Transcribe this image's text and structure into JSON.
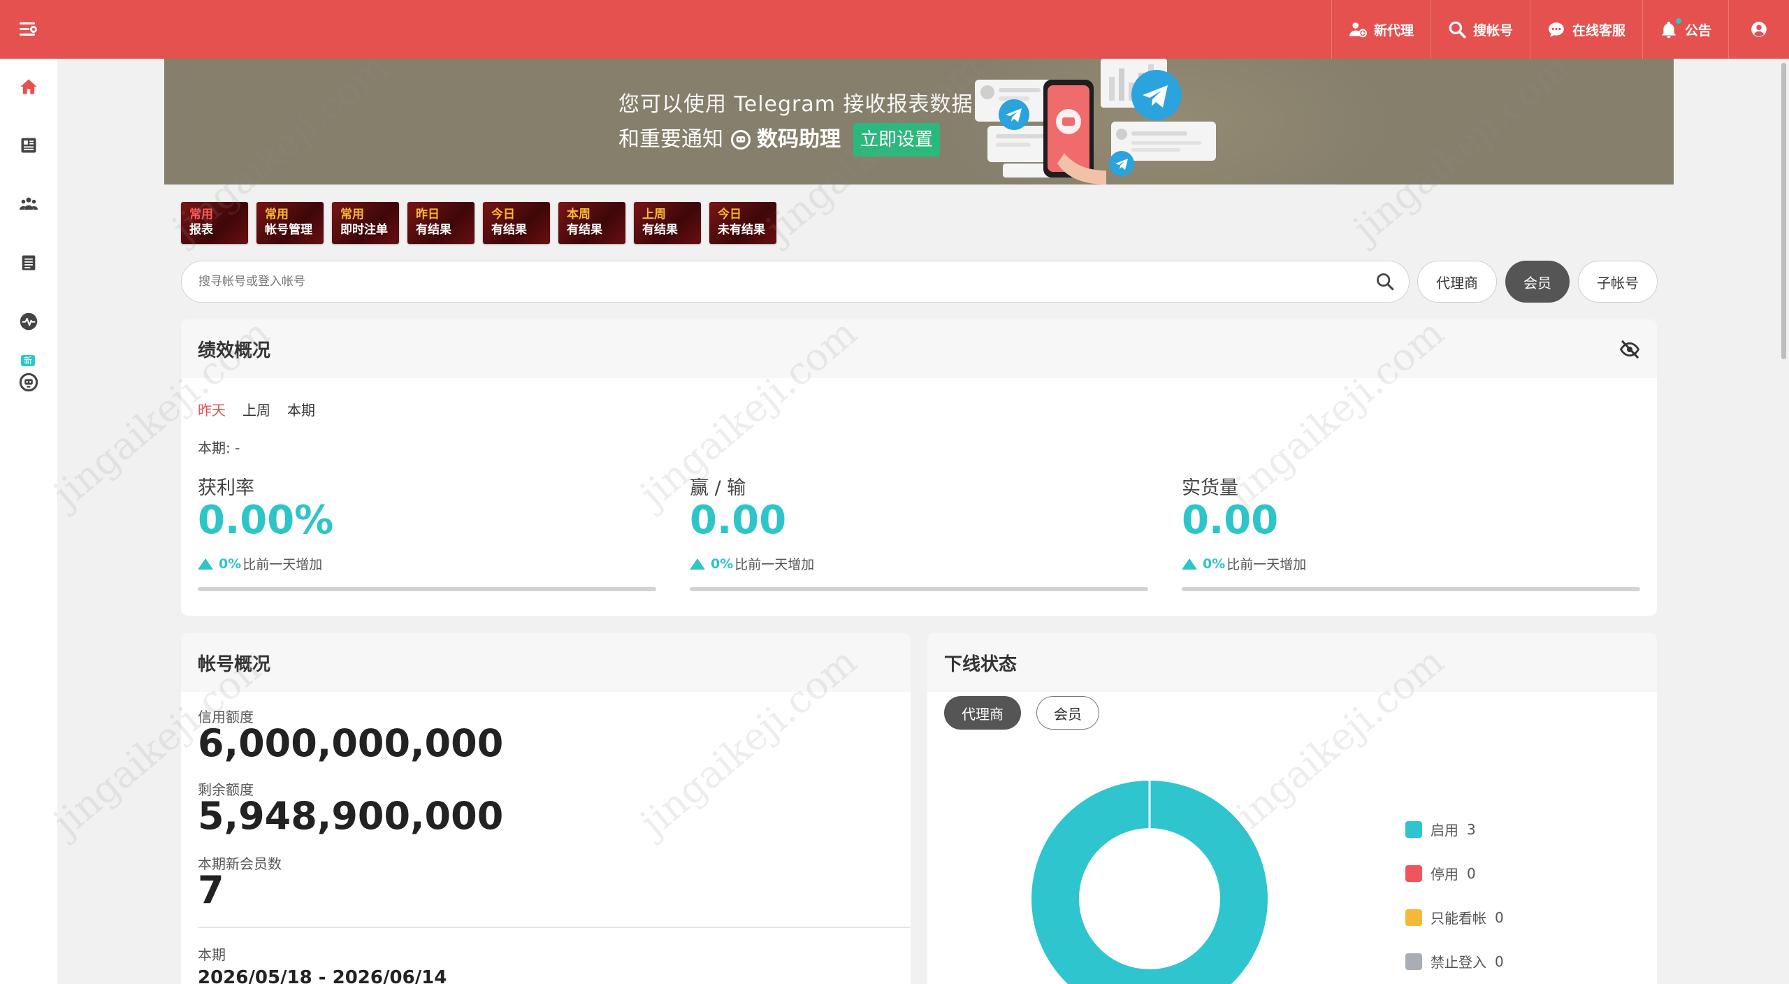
{
  "topbar": {
    "actions": [
      {
        "label": "新代理",
        "icon": "add-user-icon"
      },
      {
        "label": "搜帐号",
        "icon": "search-icon"
      },
      {
        "label": "在线客服",
        "icon": "chat-icon"
      },
      {
        "label": "公告",
        "icon": "bell-icon"
      }
    ],
    "user_icon": "user-circle-icon"
  },
  "sidebar": {
    "items": [
      {
        "icon": "home-icon",
        "active": true
      },
      {
        "icon": "report-icon"
      },
      {
        "icon": "team-icon"
      },
      {
        "icon": "list-icon"
      },
      {
        "icon": "pulse-icon"
      },
      {
        "icon": "bot-icon",
        "badge": "新"
      }
    ]
  },
  "banner": {
    "line1": "您可以使用 Telegram 接收报表数据",
    "line2_prefix": "和重要通知",
    "bot_name": "数码助理",
    "cta": "立即设置"
  },
  "shortcuts": [
    {
      "top": "常用",
      "bottom": "报表"
    },
    {
      "top": "常用",
      "bottom": "帐号管理"
    },
    {
      "top": "常用",
      "bottom": "即时注单"
    },
    {
      "top": "昨日",
      "bottom": "有结果"
    },
    {
      "top": "今日",
      "bottom": "有结果"
    },
    {
      "top": "本周",
      "bottom": "有结果"
    },
    {
      "top": "上周",
      "bottom": "有结果"
    },
    {
      "top": "今日",
      "bottom": "未有结果"
    }
  ],
  "search": {
    "placeholder": "搜寻帐号或登入帐号",
    "value": "",
    "types": [
      "代理商",
      "会员",
      "子帐号"
    ],
    "selected": "会员"
  },
  "performance": {
    "title": "绩效概况",
    "tabs": [
      "昨天",
      "上周",
      "本期"
    ],
    "active_tab": "昨天",
    "period_label": "本期: -",
    "metrics": [
      {
        "label": "获利率",
        "value": "0.00%",
        "change_pct": "0%",
        "change_text": "比前一天增加"
      },
      {
        "label": "赢 / 输",
        "value": "0.00",
        "change_pct": "0%",
        "change_text": "比前一天增加"
      },
      {
        "label": "实货量",
        "value": "0.00",
        "change_pct": "0%",
        "change_text": "比前一天增加"
      }
    ]
  },
  "accounts": {
    "title": "帐号概况",
    "credit_label": "信用额度",
    "credit_value": "6,000,000,000",
    "remaining_label": "剩余额度",
    "remaining_value": "5,948,900,000",
    "new_members_label": "本期新会员数",
    "new_members_value": "7",
    "period_label": "本期",
    "period_value": "2026/05/18 - 2026/06/14"
  },
  "downline": {
    "title": "下线状态",
    "tabs": [
      "代理商",
      "会员"
    ],
    "active_tab": "代理商",
    "legend": [
      {
        "label": "启用",
        "count": 3,
        "color": "#2ec5cf"
      },
      {
        "label": "停用",
        "count": 0,
        "color": "#f2545b"
      },
      {
        "label": "只能看帐",
        "count": 0,
        "color": "#f5b93a"
      },
      {
        "label": "禁止登入",
        "count": 0,
        "color": "#a7aeb6"
      }
    ]
  },
  "colors": {
    "topbar": "#e5514f",
    "accent": "#2ec5c9",
    "active_tab": "#e5514f"
  }
}
